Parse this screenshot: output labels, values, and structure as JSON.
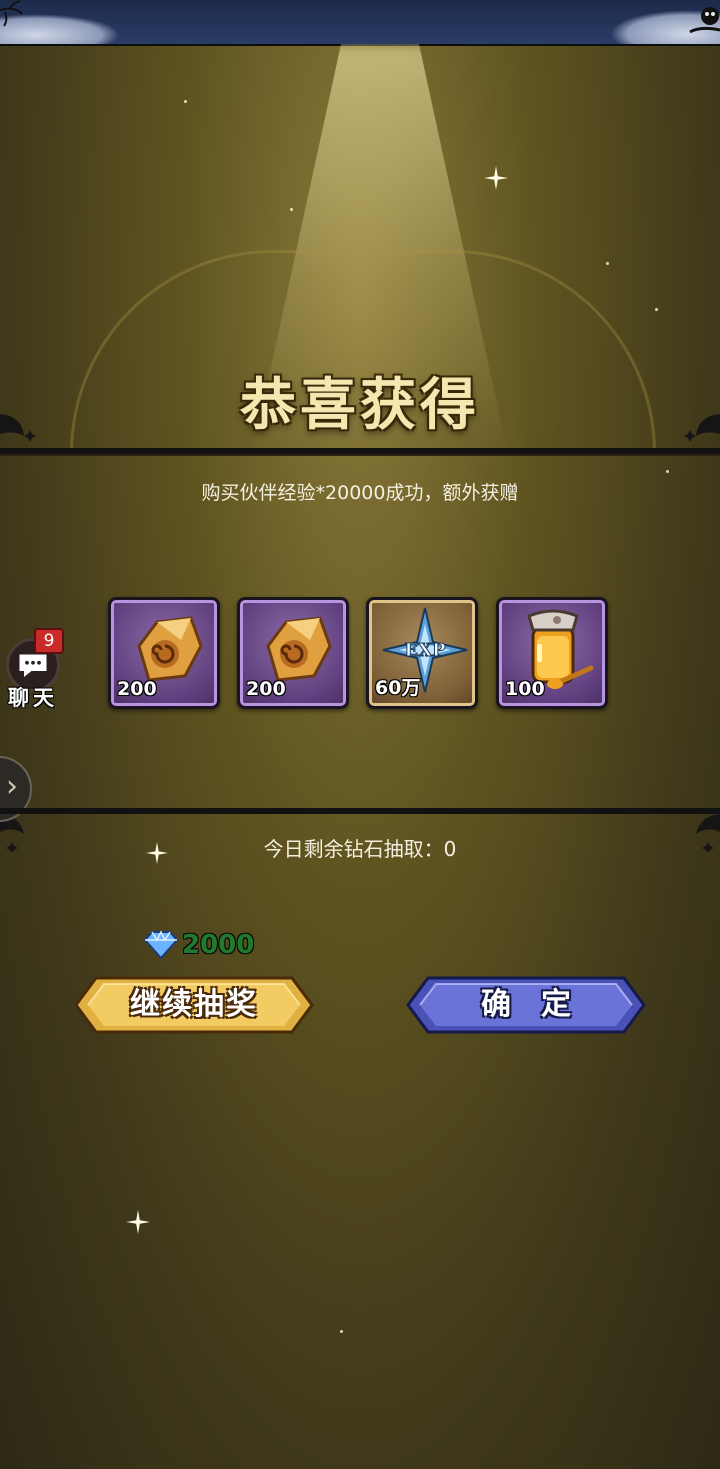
{
  "header": {
    "title": "恭喜获得"
  },
  "message": {
    "text": "购买伙伴经验*20000成功，额外获赠"
  },
  "rewards": [
    {
      "icon": "amber-stone-icon",
      "count": "200"
    },
    {
      "icon": "amber-stone-icon",
      "count": "200"
    },
    {
      "icon": "exp-star-icon",
      "count": "60万"
    },
    {
      "icon": "honey-jar-icon",
      "count": "100"
    }
  ],
  "chat": {
    "badge": "9",
    "label": "聊天"
  },
  "footer": {
    "remaining_text": "今日剩余钻石抽取：0",
    "cost": "2000",
    "continue_button": "继续抽奖",
    "confirm_button": "确定"
  },
  "colors": {
    "gold_button": "#e0b040",
    "blue_button": "#5a62c8",
    "cost_green": "#1f7a2e"
  }
}
